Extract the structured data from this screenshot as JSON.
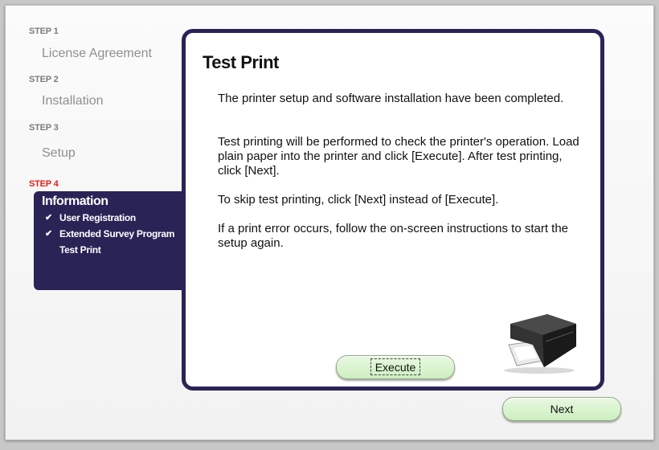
{
  "sidebar": {
    "steps": [
      {
        "step": "STEP 1",
        "title": "License Agreement"
      },
      {
        "step": "STEP 2",
        "title": "Installation"
      },
      {
        "step": "STEP 3",
        "title": "Setup"
      },
      {
        "step": "STEP 4",
        "title": "Information"
      }
    ],
    "info_items": [
      {
        "label": "User Registration",
        "check": "✔"
      },
      {
        "label": "Extended Survey Program",
        "check": "✔"
      },
      {
        "label": "Test Print",
        "check": ""
      }
    ],
    "active_step_color": "#e0201a",
    "panel_color": "#2a2356"
  },
  "main": {
    "title": "Test Print",
    "paragraphs": [
      "The printer setup and software installation have been completed.",
      "Test printing will be performed to check the printer's operation. Load plain paper into the printer and click [Execute]. After test printing, click [Next].",
      "To skip test printing, click [Next] instead of [Execute].",
      "If a print error occurs, follow the on-screen instructions to start the setup again."
    ],
    "execute_label": "Execute",
    "printer_icon": "printer-icon"
  },
  "footer": {
    "next_label": "Next"
  }
}
